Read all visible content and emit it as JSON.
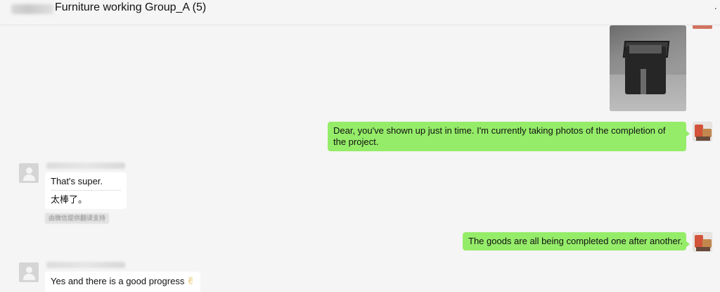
{
  "header": {
    "title": "Furniture working Group_A (5)",
    "more_icon": "more-dots-icon"
  },
  "messages": [
    {
      "side": "self",
      "type": "image",
      "image_desc": "photo-black-cabinet"
    },
    {
      "side": "self",
      "type": "text",
      "text": "Dear, you've shown up just in time. I'm currently taking photos of the completion of the project."
    },
    {
      "side": "other",
      "type": "text",
      "text": "That's super.",
      "translation": "太棒了。",
      "translation_badge": "由微信提供翻译支持"
    },
    {
      "side": "self",
      "type": "text",
      "text": "The goods are all being completed one after another."
    },
    {
      "side": "other",
      "type": "text",
      "text": "Yes and there is a good progress",
      "emoji": "✌"
    }
  ],
  "colors": {
    "self_bubble": "#95ec69",
    "other_bubble": "#ffffff",
    "background": "#f5f5f5"
  }
}
